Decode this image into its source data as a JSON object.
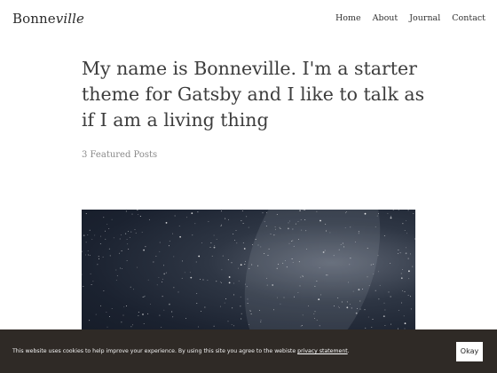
{
  "header": {
    "logo_main": "Bonne",
    "logo_italic": "ville",
    "nav": [
      "Home",
      "About",
      "Journal",
      "Contact"
    ]
  },
  "hero": {
    "headline": "My name is Bonneville. I'm a starter theme for Gatsby and I like to talk as if I am a living thing",
    "featured_label": "3 Featured Posts"
  },
  "cookie": {
    "text": "This website uses cookies to help improve your experience. By using this site you agree to the webiste",
    "link": "privacy statement",
    "period": ".",
    "button": "Okay"
  }
}
